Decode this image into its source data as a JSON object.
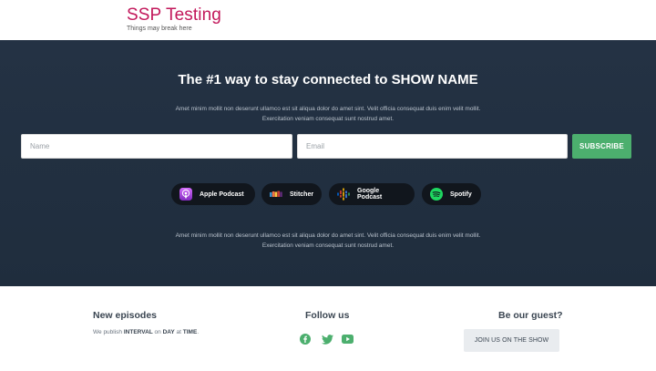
{
  "header": {
    "site_title": "SSP Testing",
    "tagline": "Things may break here",
    "brand_color": "#c2185b"
  },
  "hero": {
    "title": "The #1 way to stay connected to SHOW NAME",
    "description": "Amet minim mollit non deserunt ullamco est sit aliqua dolor do amet sint. Velit officia consequat duis enim velit mollit. Exercitation veniam consequat sunt nostrud amet.",
    "form": {
      "name_placeholder": "Name",
      "email_placeholder": "Email",
      "subscribe_label": "SUBSCRIBE",
      "accent": "#4caf6e"
    },
    "platforms": [
      {
        "label": "Apple Podcast",
        "icon": "apple-podcast-icon"
      },
      {
        "label": "Stitcher",
        "icon": "stitcher-icon"
      },
      {
        "label": "Google Podcast",
        "icon": "google-podcast-icon"
      },
      {
        "label": "Spotify",
        "icon": "spotify-icon"
      }
    ],
    "footer_text": "Amet minim mollit non deserunt ullamco est sit aliqua dolor do amet sint. Velit officia consequat duis enim velit mollit. Exercitation veniam consequat sunt nostrud amet.",
    "background": "#243244"
  },
  "footer": {
    "new_episodes": {
      "title": "New episodes",
      "text_prefix": "We publish ",
      "interval": "INTERVAL",
      "text_on": " on ",
      "day": "DAY",
      "text_at": " at ",
      "time": "TIME",
      "text_end": "."
    },
    "follow_us": {
      "title": "Follow us",
      "icons": [
        "facebook-icon",
        "twitter-icon",
        "youtube-icon"
      ],
      "icon_color": "#4caf6e"
    },
    "guest": {
      "title": "Be our guest?",
      "button_label": "JOIN US ON THE SHOW"
    }
  }
}
